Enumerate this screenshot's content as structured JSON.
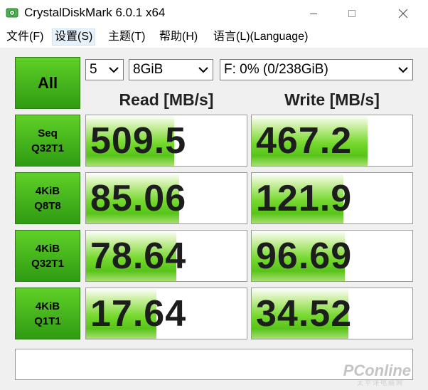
{
  "window": {
    "title": "CrystalDiskMark 6.0.1 x64"
  },
  "menu": [
    {
      "label": "文件(F)",
      "selected": false
    },
    {
      "label": "设置(S)",
      "selected": true
    },
    {
      "label": "主题(T)",
      "selected": false
    },
    {
      "label": "帮助(H)",
      "selected": false
    },
    {
      "label": "语言(L)(Language)",
      "selected": false
    }
  ],
  "controls": {
    "all_label": "All",
    "count": "5",
    "size": "8GiB",
    "drive": "F: 0% (0/238GiB)"
  },
  "headers": {
    "read": "Read [MB/s]",
    "write": "Write [MB/s]"
  },
  "tests": [
    {
      "line1": "Seq",
      "line2": "Q32T1",
      "read": "509.5",
      "write": "467.2",
      "read_fill": 0.55,
      "write_fill": 0.72
    },
    {
      "line1": "4KiB",
      "line2": "Q8T8",
      "read": "85.06",
      "write": "121.9",
      "read_fill": 0.58,
      "write_fill": 0.57
    },
    {
      "line1": "4KiB",
      "line2": "Q32T1",
      "read": "78.64",
      "write": "96.69",
      "read_fill": 0.56,
      "write_fill": 0.58
    },
    {
      "line1": "4KiB",
      "line2": "Q1T1",
      "read": "17.64",
      "write": "34.52",
      "read_fill": 0.44,
      "write_fill": 0.6
    }
  ],
  "comment": "",
  "watermark": {
    "brand": "PConline",
    "sub": "太平洋电脑网"
  }
}
